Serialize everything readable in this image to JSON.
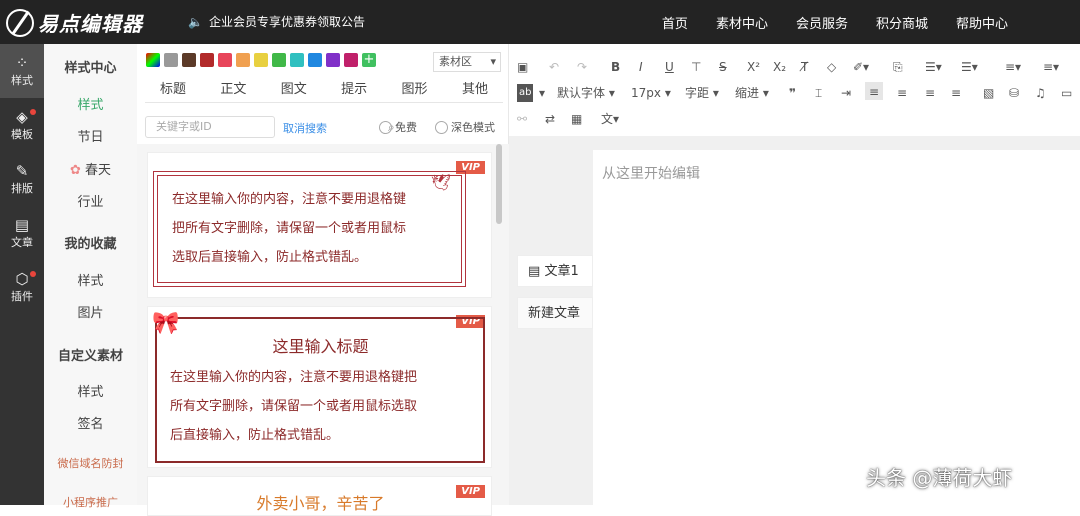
{
  "header": {
    "logo_text": "易点编辑器",
    "announcement": "企业会员专享优惠券领取公告",
    "nav": [
      "首页",
      "素材中心",
      "会员服务",
      "积分商城",
      "帮助中心"
    ]
  },
  "icon_rail": [
    {
      "label": "样式",
      "icon": "grid-icon"
    },
    {
      "label": "模板",
      "icon": "layers-icon"
    },
    {
      "label": "排版",
      "icon": "edit-icon"
    },
    {
      "label": "文章",
      "icon": "document-icon"
    },
    {
      "label": "插件",
      "icon": "cube-icon"
    }
  ],
  "sidebar": {
    "style_center": "样式中心",
    "items": [
      "样式",
      "节日",
      "春天",
      "行业"
    ],
    "favorites": "我的收藏",
    "fav_items": [
      "样式",
      "图片"
    ],
    "custom": "自定义素材",
    "custom_items": [
      "样式",
      "签名"
    ],
    "promo1": "微信域名防封",
    "promo2": "小程序推广"
  },
  "panel": {
    "swatch_colors": [
      "#e74c3c",
      "#999999",
      "#5c3a28",
      "#b22a2a",
      "#e8455a",
      "#f0a050",
      "#e8d040",
      "#40b848",
      "#30c0c0",
      "#2088e0",
      "#8030c8",
      "#c0206a",
      "#40c060"
    ],
    "material_select": "素材区",
    "tabs": [
      "标题",
      "正文",
      "图文",
      "提示",
      "图形",
      "其他"
    ],
    "search_placeholder": "关键字或ID",
    "cancel_search": "取消搜索",
    "free": "免费",
    "dark_mode": "深色模式",
    "vip": "VIP",
    "card1_lines": [
      "在这里输入你的内容，注意不要用退格键",
      "把所有文字删除，请保留一个或者用鼠标",
      "选取后直接输入，防止格式错乱。"
    ],
    "card2_title": "这里输入标题",
    "card2_lines": [
      "在这里输入你的内容，注意不要用退格键把",
      "所有文字删除，请保留一个或者用鼠标选取",
      "后直接输入，防止格式错乱。"
    ],
    "card3_title": "外卖小哥，辛苦了"
  },
  "toolbar": {
    "font": "默认字体",
    "size": "17px",
    "spacing": "字距",
    "indent": "缩进"
  },
  "editor": {
    "placeholder": "从这里开始编辑",
    "articles": [
      "文章1",
      "新建文章"
    ]
  },
  "watermark": "头条 @薄荷大虾"
}
